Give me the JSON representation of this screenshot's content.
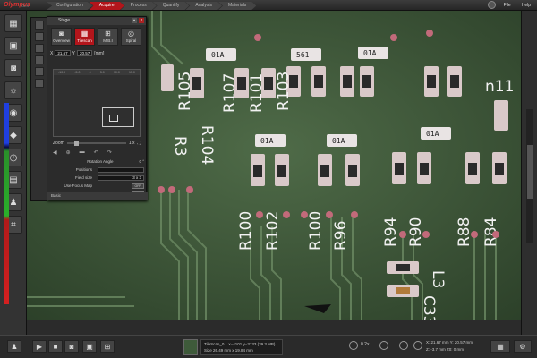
{
  "app": {
    "logo": "Olympus",
    "logo_sub": "OLS"
  },
  "workflow": {
    "tabs": [
      "Configuration",
      "Acquire",
      "Process",
      "Quantify",
      "Analysis",
      "Materials"
    ],
    "active": "Acquire"
  },
  "menu": {
    "file": "File",
    "help": "Help"
  },
  "stage_panel": {
    "title": "Stage",
    "modes": [
      {
        "label": "Overview",
        "icon": "camera-icon"
      },
      {
        "label": "Tilescan",
        "icon": "tilescan-icon"
      },
      {
        "label": "M.B.I",
        "icon": "grid-icon"
      },
      {
        "label": "Spiral",
        "icon": "spiral-icon"
      }
    ],
    "active_mode": "Tilescan",
    "x_label": "X",
    "x_value": "21.67",
    "y_label": "Y",
    "y_value": "20.57",
    "unit": "[mm]",
    "ruler_ticks": [
      "-10.0",
      "-5.0",
      "0",
      "5.0",
      "10.0",
      "15.0"
    ],
    "zoom_label": "Zoom",
    "zoom_value": "1 x",
    "rotation_label": "Rotation Angle :",
    "rotation_value": "0 °",
    "positions_label": "Positions",
    "positions_value": "",
    "field_size_label": "Field size",
    "field_size_value": "3 x 3",
    "focus_map_label": "Use Focus Map",
    "focus_map_state": "OFF",
    "merge_label": "Merge Images",
    "merge_state": "ON",
    "footer": "Basic"
  },
  "status": {
    "line1": "TileScan_0... x=4101 y=3133  (39.3 MB)",
    "line2": "Size 26.49 mm x 19.84 mm"
  },
  "readout": {
    "line1": "X: 21.67 mm  Y: 20.57 mm",
    "line2": "Z: -3.7 mm  Z0: 0 mm"
  },
  "bottom": {
    "zoom": "0.2x"
  },
  "colors": {
    "accent": "#b3151b",
    "board": "#3f5a3b"
  }
}
